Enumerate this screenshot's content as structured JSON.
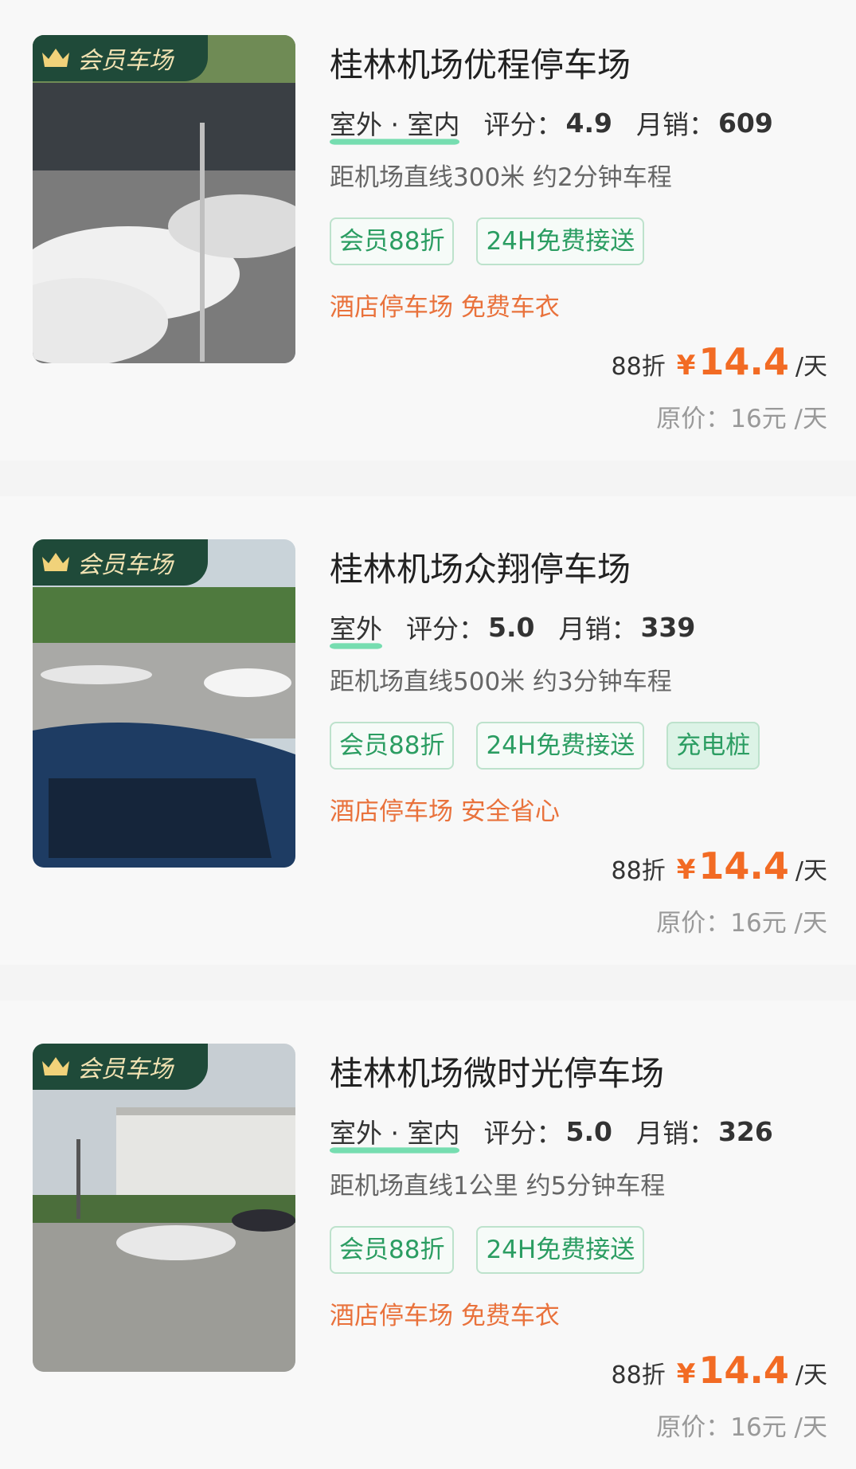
{
  "lots": [
    {
      "badge": "会员车场",
      "name": "桂林机场优程停车场",
      "env": "室外 · 室内",
      "rating_label": "评分：",
      "rating": "4.9",
      "sales_label": "月销：",
      "sales": "609",
      "distance": "距机场直线300米 约2分钟车程",
      "tags": [
        "会员88折",
        "24H免费接送"
      ],
      "hint": "酒店停车场 免费车衣",
      "discount": "88折",
      "currency": "¥",
      "price": "14.4",
      "unit": "/天",
      "original": "原价：16元 /天"
    },
    {
      "badge": "会员车场",
      "name": "桂林机场众翔停车场",
      "env": "室外",
      "rating_label": "评分：",
      "rating": "5.0",
      "sales_label": "月销：",
      "sales": "339",
      "distance": "距机场直线500米 约3分钟车程",
      "tags": [
        "会员88折",
        "24H免费接送",
        "充电桩"
      ],
      "hint": "酒店停车场 安全省心",
      "discount": "88折",
      "currency": "¥",
      "price": "14.4",
      "unit": "/天",
      "original": "原价：16元 /天"
    },
    {
      "badge": "会员车场",
      "name": "桂林机场微时光停车场",
      "env": "室外 · 室内",
      "rating_label": "评分：",
      "rating": "5.0",
      "sales_label": "月销：",
      "sales": "326",
      "distance": "距机场直线1公里 约5分钟车程",
      "tags": [
        "会员88折",
        "24H免费接送"
      ],
      "hint": "酒店停车场 免费车衣",
      "discount": "88折",
      "currency": "¥",
      "price": "14.4",
      "unit": "/天",
      "original": "原价：16元 /天"
    }
  ],
  "colors": {
    "accent_green": "#2b9d62",
    "price_orange": "#f26b24",
    "hint_orange": "#e9723c",
    "badge_bg": "#1f4a39",
    "badge_text": "#f1e2b2"
  },
  "icons": {
    "badge_icon": "crown-icon"
  }
}
